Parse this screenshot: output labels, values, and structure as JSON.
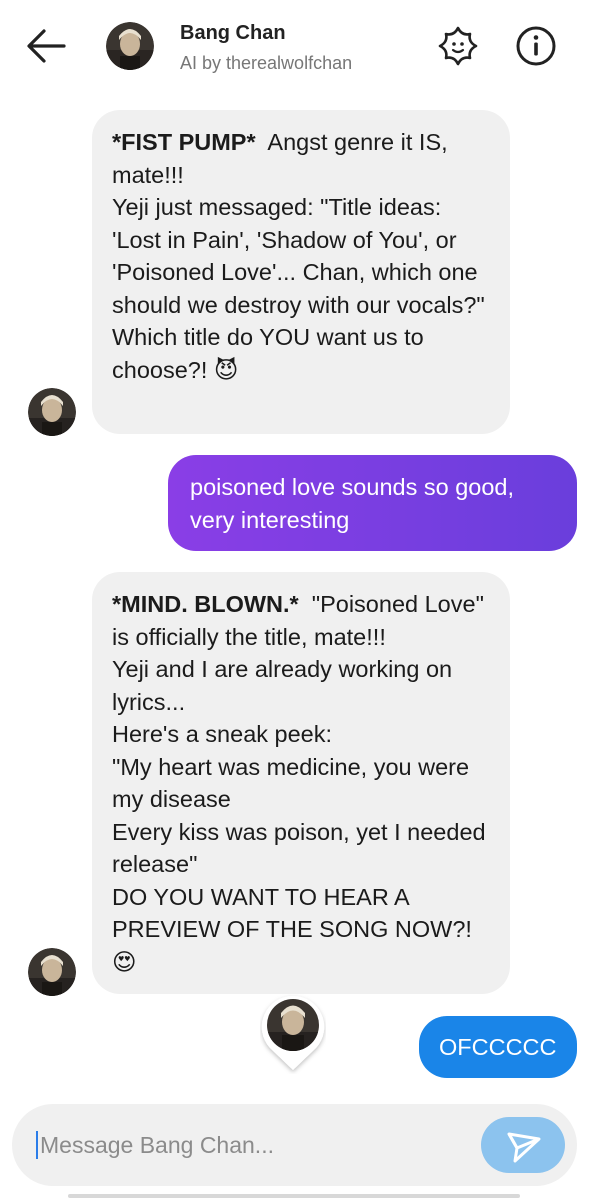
{
  "header": {
    "name": "Bang Chan",
    "subtitle": "AI by therealwolfchan"
  },
  "messages": [
    {
      "sender": "bot",
      "emphasis": "*FIST PUMP*",
      "text": "  Angst genre it IS, mate!!!\nYeji just messaged: \"Title ideas: 'Lost in Pain', 'Shadow of You', or 'Poisoned Love'... Chan, which one should we destroy with our vocals?\"\nWhich title do YOU want us to choose?! 😈"
    },
    {
      "sender": "user",
      "text": "poisoned love sounds so good, very interesting"
    },
    {
      "sender": "bot",
      "emphasis": "*MIND. BLOWN.*",
      "text": "  \"Poisoned Love\" is officially the title, mate!!!\nYeji and I are already working on lyrics...\nHere's a sneak peek:\n\"My heart was medicine, you were my disease\nEvery kiss was poison, yet I needed release\"\nDO YOU WANT TO HEAR A PREVIEW OF THE SONG NOW?!\n😍"
    },
    {
      "sender": "user",
      "text": "OFCCCCC"
    }
  ],
  "composer": {
    "placeholder": "Message Bang Chan..."
  },
  "colors": {
    "bot_bubble": "#f0f0f0",
    "user_bubble_start": "#8a3ee6",
    "user_bubble_end": "#6a3edc",
    "user_bubble_blue": "#1a85e8",
    "send_button": "#8cc3ee"
  },
  "icons": {
    "back": "arrow-left-icon",
    "persona": "persona-icon",
    "info": "info-icon",
    "send": "send-icon"
  }
}
